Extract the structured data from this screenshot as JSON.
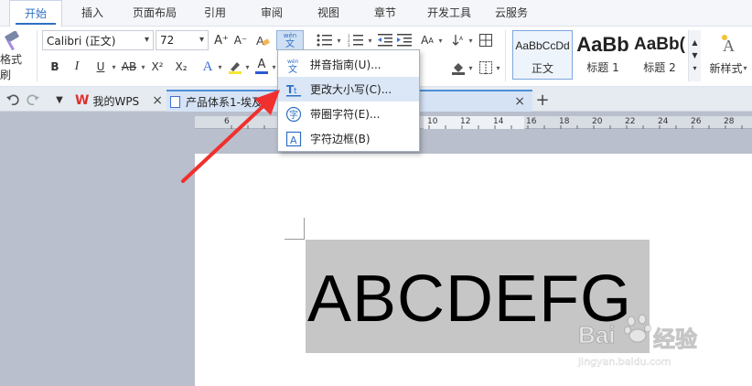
{
  "menu_tabs": [
    {
      "label": "开始",
      "active": true
    },
    {
      "label": "插入"
    },
    {
      "label": "页面布局"
    },
    {
      "label": "引用"
    },
    {
      "label": "审阅"
    },
    {
      "label": "视图"
    },
    {
      "label": "章节"
    },
    {
      "label": "开发工具"
    },
    {
      "label": "云服务"
    }
  ],
  "ribbon": {
    "format_painter_label": "格式刷",
    "font_name": "Calibri (正文)",
    "font_size": "72",
    "bold": "B",
    "italic": "I",
    "underline": "U",
    "strike": "AB",
    "superscript": "X²",
    "subscript": "X₂",
    "text_effect": "A",
    "font_color": "A",
    "grow_font": "A⁺",
    "shrink_font": "A⁻",
    "phonetic_top": "wén",
    "phonetic_bottom": "文",
    "styles": [
      {
        "sample": "AaBbCcDd",
        "name": "正文"
      },
      {
        "sample": "AaBb",
        "name": "标题 1"
      },
      {
        "sample": "AaBb(",
        "name": "标题 2"
      }
    ],
    "new_style_label": "新样式"
  },
  "doc_tabs": {
    "my_wps": "我的WPS",
    "doc_title": "产品体系1-埃及",
    "add": "+",
    "close": "×"
  },
  "ruler_numbers": [
    "6",
    "10",
    "12",
    "14",
    "16",
    "18",
    "20",
    "22",
    "24",
    "26",
    "28"
  ],
  "document": {
    "text": "ABCDEFG"
  },
  "dropdown": {
    "items": [
      {
        "label": "拼音指南(U)...",
        "icon": "pinyin-guide-icon"
      },
      {
        "label": "更改大小写(C)...",
        "icon": "change-case-icon"
      },
      {
        "label": "带圈字符(E)...",
        "icon": "enclosed-char-icon"
      },
      {
        "label": "字符边框(B)",
        "icon": "char-border-icon"
      }
    ]
  },
  "watermark": {
    "brand": "Bai",
    "brand_cn": "经验",
    "url": "jingyan.baidu.com"
  },
  "colors": {
    "accent": "#2f6fc4",
    "arrow": "#f0302e",
    "selection": "#c6c6c6",
    "workspace": "#b9bfcc"
  }
}
